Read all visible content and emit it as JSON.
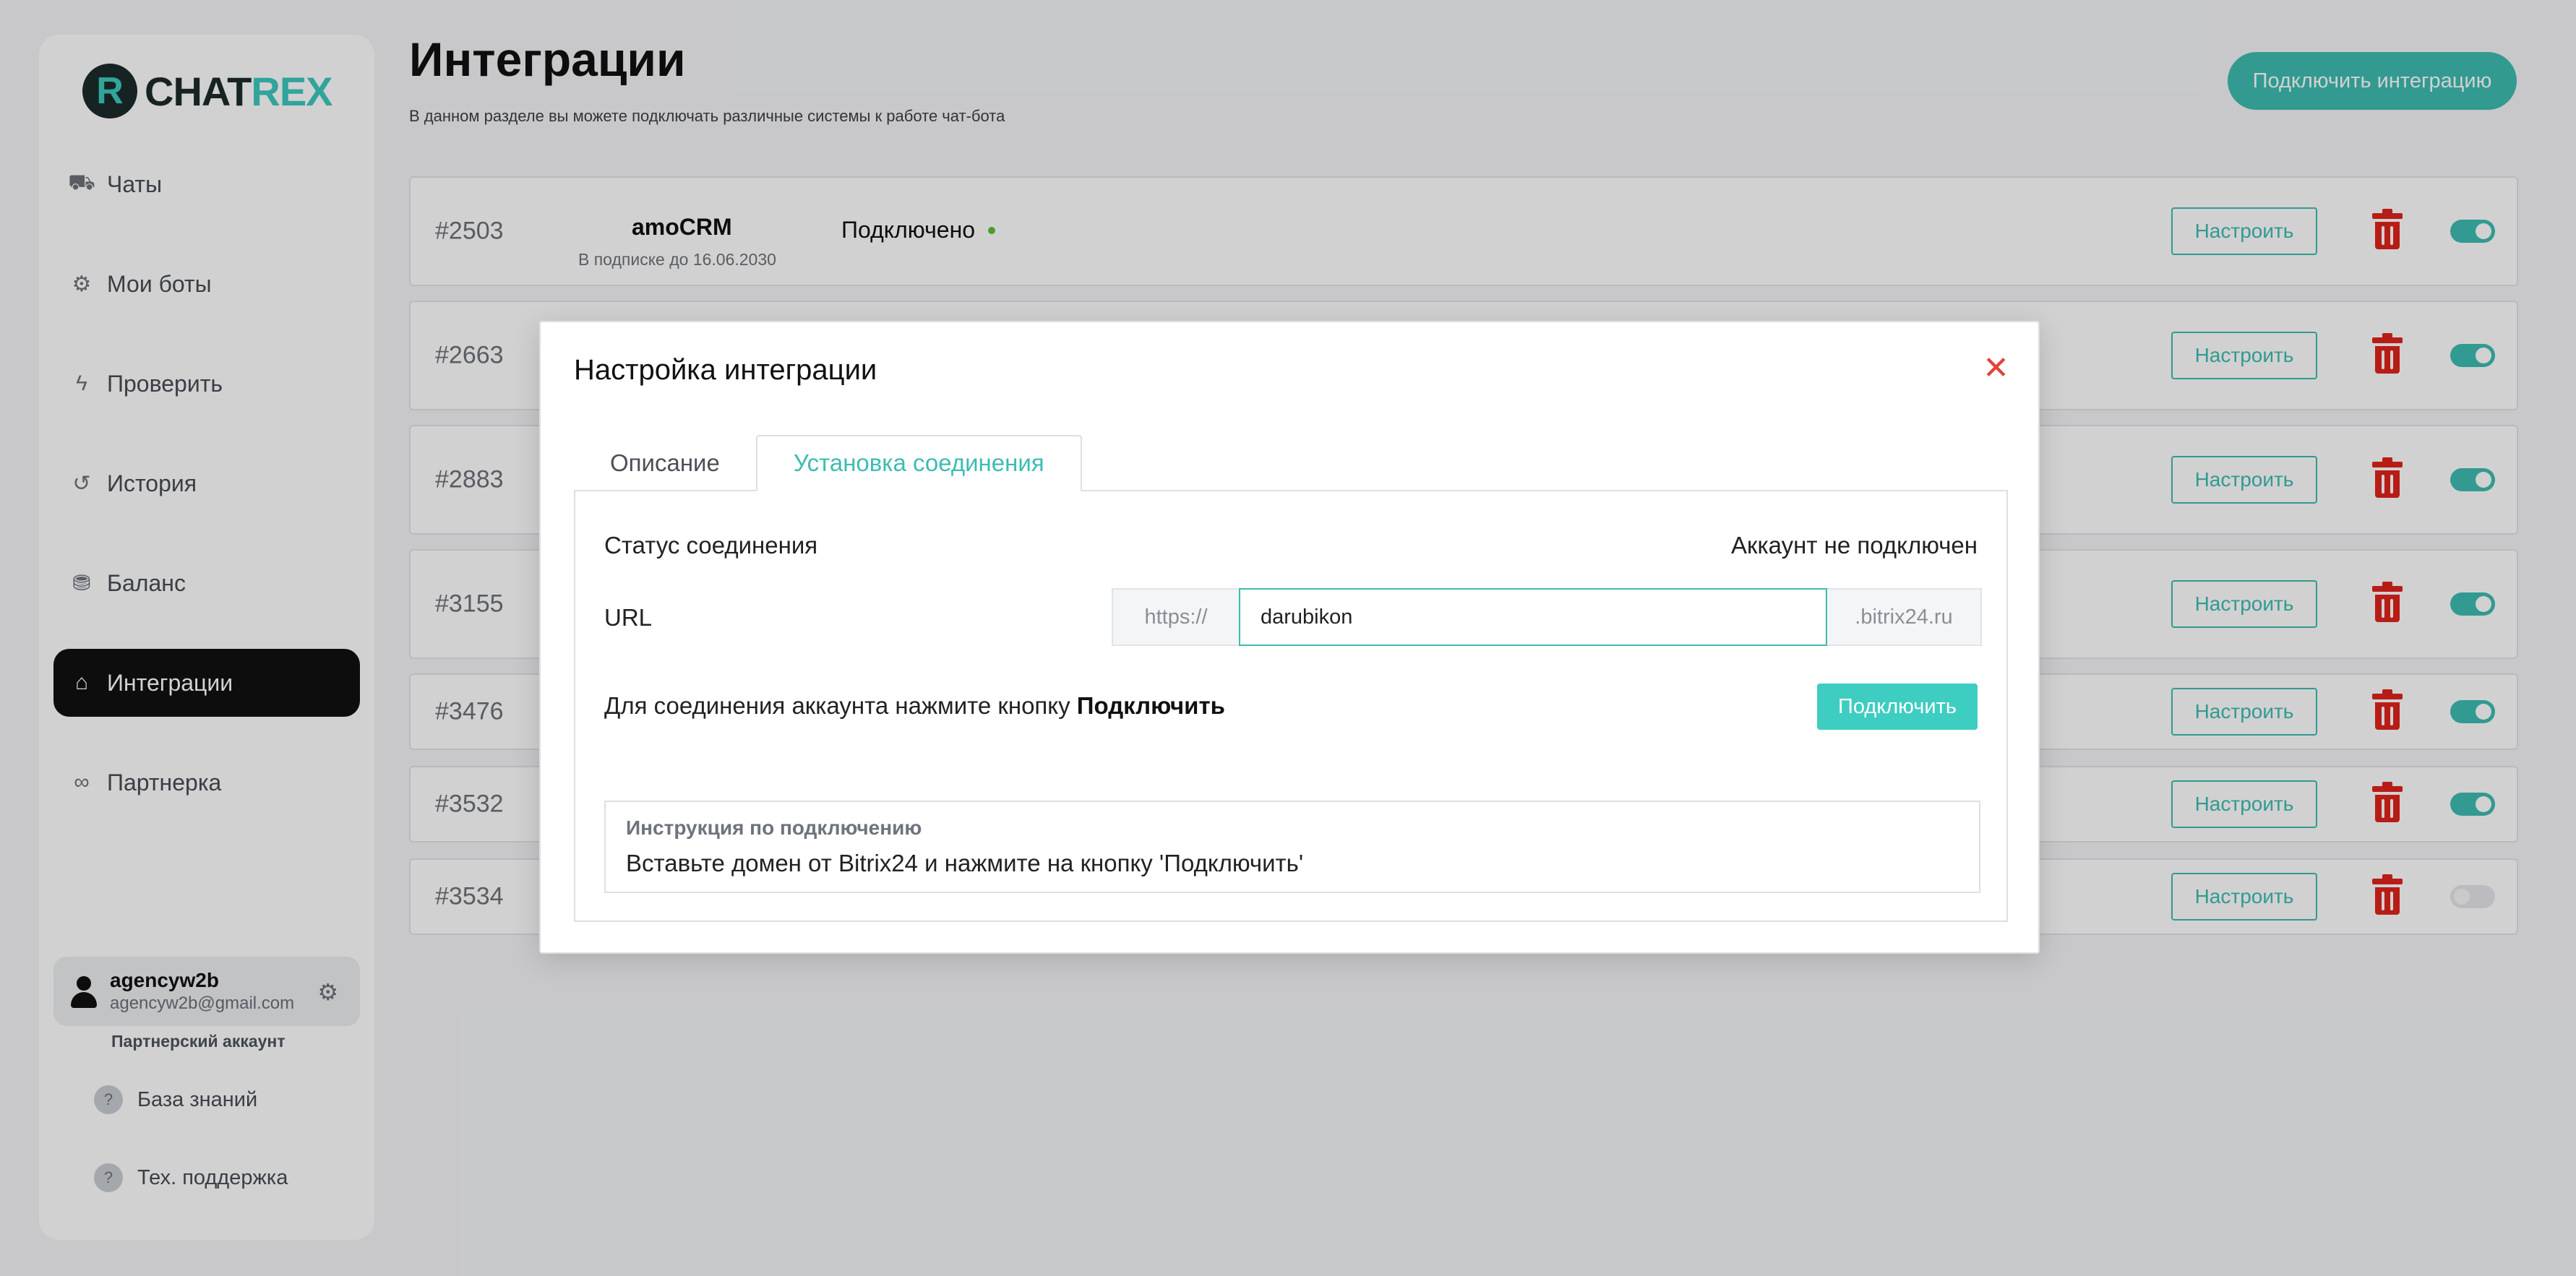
{
  "brand": {
    "mark": "R",
    "name_a": "CHAT",
    "name_b": "REX"
  },
  "sidebar": {
    "items": [
      {
        "label": "Чаты",
        "icon": "chats-icon",
        "glyph": "⛟"
      },
      {
        "label": "Мои боты",
        "icon": "bots-icon",
        "glyph": "⚙"
      },
      {
        "label": "Проверить",
        "icon": "lightning-icon",
        "glyph": "ϟ"
      },
      {
        "label": "История",
        "icon": "history-icon",
        "glyph": "↺"
      },
      {
        "label": "Баланс",
        "icon": "coins-icon",
        "glyph": "⛃"
      },
      {
        "label": "Интеграции",
        "icon": "store-icon",
        "glyph": "⌂",
        "active": true
      },
      {
        "label": "Партнерка",
        "icon": "handshake-icon",
        "glyph": "∞"
      }
    ],
    "user": {
      "name": "agencyw2b",
      "email": "agencyw2b@gmail.com",
      "role": "Партнерский аккаунт"
    },
    "footer_links": [
      {
        "label": "База знаний",
        "icon": "knowledge-icon"
      },
      {
        "label": "Тех. поддержка",
        "icon": "support-icon"
      }
    ]
  },
  "header": {
    "title": "Интеграции",
    "subtitle": "В данном разделе вы можете подключать различные системы к работе чат-бота",
    "connect_button": "Подключить интеграцию"
  },
  "integrations": [
    {
      "id": "#2503",
      "name": "amoCRM",
      "note": "В подписке до 16.06.2030",
      "status": "Подключено",
      "setup_label": "Настроить",
      "enabled": true
    },
    {
      "id": "#2663",
      "setup_label": "Настроить",
      "enabled": true
    },
    {
      "id": "#2883",
      "setup_label": "Настроить",
      "enabled": true
    },
    {
      "id": "#3155",
      "setup_label": "Настроить",
      "enabled": true
    },
    {
      "id": "#3476",
      "setup_label": "Настроить",
      "enabled": true
    },
    {
      "id": "#3532",
      "setup_label": "Настроить",
      "enabled": true
    },
    {
      "id": "#3534",
      "setup_label": "Настроить",
      "enabled": false
    }
  ],
  "modal": {
    "title": "Настройка интеграции",
    "tabs": [
      {
        "label": "Описание"
      },
      {
        "label": "Установка соединения",
        "active": true
      }
    ],
    "status_label": "Статус соединения",
    "status_value": "Аккаунт не подключен",
    "url_label": "URL",
    "url_prefix": "https://",
    "url_value": "darubikon",
    "url_suffix": ".bitrix24.ru",
    "connect_text": "Для соединения аккаунта нажмите кнопку",
    "connect_text_bold": "Подключить",
    "connect_button": "Подключить",
    "instruction_title": "Инструкция по подключению",
    "instruction_text": "Вставьте домен от Bitrix24 и нажмите на кнопку 'Подключить'"
  },
  "colors": {
    "accent": "#3ebcb1",
    "danger": "#e0241c",
    "active_nav": "#111111",
    "status_dot": "#5cbd3a"
  }
}
